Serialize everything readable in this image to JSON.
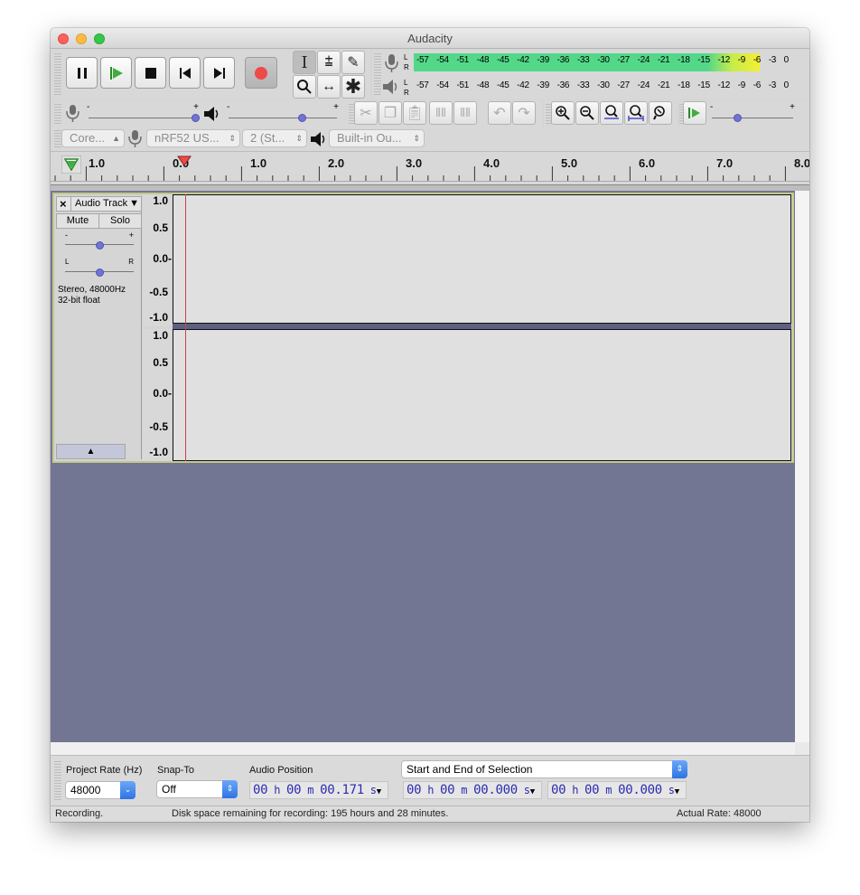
{
  "window": {
    "title": "Audacity"
  },
  "meters": {
    "rec_ticks": [
      "-57",
      "-54",
      "-51",
      "-48",
      "-45",
      "-42",
      "-39",
      "-36",
      "-33",
      "-30",
      "-27",
      "-24",
      "-21",
      "-18",
      "-15",
      "-12",
      "-9",
      "-6",
      "-3",
      "0"
    ],
    "play_ticks": [
      "-57",
      "-54",
      "-51",
      "-48",
      "-45",
      "-42",
      "-39",
      "-36",
      "-33",
      "-30",
      "-27",
      "-24",
      "-21",
      "-18",
      "-15",
      "-12",
      "-9",
      "-6",
      "-3",
      "0"
    ],
    "L": "L",
    "R": "R"
  },
  "device": {
    "host": "Core...",
    "rec_device": "nRF52 US...",
    "channels": "2 (St...",
    "play_device": "Built-in Ou..."
  },
  "ruler": {
    "labels": [
      "1.0",
      "0.0",
      "1.0",
      "2.0",
      "3.0",
      "4.0",
      "5.0",
      "6.0",
      "7.0",
      "8.0"
    ]
  },
  "track": {
    "name": "Audio Track",
    "close": "×",
    "mute": "Mute",
    "solo": "Solo",
    "info_line1": "Stereo, 48000Hz",
    "info_line2": "32-bit float",
    "gain_minus": "-",
    "gain_plus": "+",
    "pan_left": "L",
    "pan_right": "R",
    "collapse": "▲",
    "vlabels": [
      "1.0",
      "0.5",
      "0.0-",
      "-0.5",
      "-1.0"
    ]
  },
  "selection": {
    "project_rate_label": "Project Rate (Hz)",
    "project_rate_value": "48000",
    "snap_label": "Snap-To",
    "snap_value": "Off",
    "audio_position_label": "Audio Position",
    "audio_position": {
      "h": "00",
      "m": "00",
      "s": "00.171"
    },
    "selection_mode": "Start and End of Selection",
    "sel_start": {
      "h": "00",
      "m": "00",
      "s": "00.000"
    },
    "sel_end": {
      "h": "00",
      "m": "00",
      "s": "00.000"
    }
  },
  "status": {
    "state": "Recording.",
    "disk": "Disk space remaining for recording: 195 hours and 28 minutes.",
    "rate": "Actual Rate: 48000"
  }
}
